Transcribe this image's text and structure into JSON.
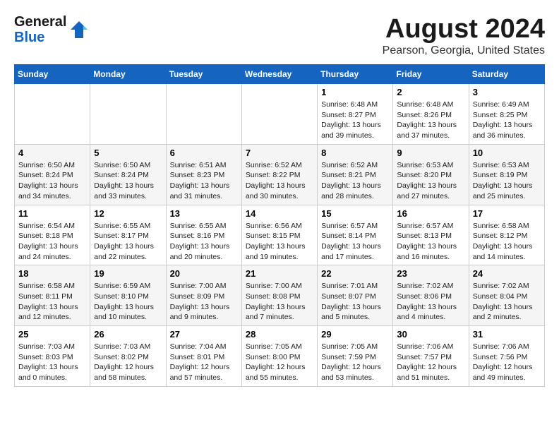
{
  "header": {
    "logo_line1": "General",
    "logo_line2": "Blue",
    "month": "August 2024",
    "location": "Pearson, Georgia, United States"
  },
  "weekdays": [
    "Sunday",
    "Monday",
    "Tuesday",
    "Wednesday",
    "Thursday",
    "Friday",
    "Saturday"
  ],
  "weeks": [
    [
      {
        "day": "",
        "info": ""
      },
      {
        "day": "",
        "info": ""
      },
      {
        "day": "",
        "info": ""
      },
      {
        "day": "",
        "info": ""
      },
      {
        "day": "1",
        "info": "Sunrise: 6:48 AM\nSunset: 8:27 PM\nDaylight: 13 hours\nand 39 minutes."
      },
      {
        "day": "2",
        "info": "Sunrise: 6:48 AM\nSunset: 8:26 PM\nDaylight: 13 hours\nand 37 minutes."
      },
      {
        "day": "3",
        "info": "Sunrise: 6:49 AM\nSunset: 8:25 PM\nDaylight: 13 hours\nand 36 minutes."
      }
    ],
    [
      {
        "day": "4",
        "info": "Sunrise: 6:50 AM\nSunset: 8:24 PM\nDaylight: 13 hours\nand 34 minutes."
      },
      {
        "day": "5",
        "info": "Sunrise: 6:50 AM\nSunset: 8:24 PM\nDaylight: 13 hours\nand 33 minutes."
      },
      {
        "day": "6",
        "info": "Sunrise: 6:51 AM\nSunset: 8:23 PM\nDaylight: 13 hours\nand 31 minutes."
      },
      {
        "day": "7",
        "info": "Sunrise: 6:52 AM\nSunset: 8:22 PM\nDaylight: 13 hours\nand 30 minutes."
      },
      {
        "day": "8",
        "info": "Sunrise: 6:52 AM\nSunset: 8:21 PM\nDaylight: 13 hours\nand 28 minutes."
      },
      {
        "day": "9",
        "info": "Sunrise: 6:53 AM\nSunset: 8:20 PM\nDaylight: 13 hours\nand 27 minutes."
      },
      {
        "day": "10",
        "info": "Sunrise: 6:53 AM\nSunset: 8:19 PM\nDaylight: 13 hours\nand 25 minutes."
      }
    ],
    [
      {
        "day": "11",
        "info": "Sunrise: 6:54 AM\nSunset: 8:18 PM\nDaylight: 13 hours\nand 24 minutes."
      },
      {
        "day": "12",
        "info": "Sunrise: 6:55 AM\nSunset: 8:17 PM\nDaylight: 13 hours\nand 22 minutes."
      },
      {
        "day": "13",
        "info": "Sunrise: 6:55 AM\nSunset: 8:16 PM\nDaylight: 13 hours\nand 20 minutes."
      },
      {
        "day": "14",
        "info": "Sunrise: 6:56 AM\nSunset: 8:15 PM\nDaylight: 13 hours\nand 19 minutes."
      },
      {
        "day": "15",
        "info": "Sunrise: 6:57 AM\nSunset: 8:14 PM\nDaylight: 13 hours\nand 17 minutes."
      },
      {
        "day": "16",
        "info": "Sunrise: 6:57 AM\nSunset: 8:13 PM\nDaylight: 13 hours\nand 16 minutes."
      },
      {
        "day": "17",
        "info": "Sunrise: 6:58 AM\nSunset: 8:12 PM\nDaylight: 13 hours\nand 14 minutes."
      }
    ],
    [
      {
        "day": "18",
        "info": "Sunrise: 6:58 AM\nSunset: 8:11 PM\nDaylight: 13 hours\nand 12 minutes."
      },
      {
        "day": "19",
        "info": "Sunrise: 6:59 AM\nSunset: 8:10 PM\nDaylight: 13 hours\nand 10 minutes."
      },
      {
        "day": "20",
        "info": "Sunrise: 7:00 AM\nSunset: 8:09 PM\nDaylight: 13 hours\nand 9 minutes."
      },
      {
        "day": "21",
        "info": "Sunrise: 7:00 AM\nSunset: 8:08 PM\nDaylight: 13 hours\nand 7 minutes."
      },
      {
        "day": "22",
        "info": "Sunrise: 7:01 AM\nSunset: 8:07 PM\nDaylight: 13 hours\nand 5 minutes."
      },
      {
        "day": "23",
        "info": "Sunrise: 7:02 AM\nSunset: 8:06 PM\nDaylight: 13 hours\nand 4 minutes."
      },
      {
        "day": "24",
        "info": "Sunrise: 7:02 AM\nSunset: 8:04 PM\nDaylight: 13 hours\nand 2 minutes."
      }
    ],
    [
      {
        "day": "25",
        "info": "Sunrise: 7:03 AM\nSunset: 8:03 PM\nDaylight: 13 hours\nand 0 minutes."
      },
      {
        "day": "26",
        "info": "Sunrise: 7:03 AM\nSunset: 8:02 PM\nDaylight: 12 hours\nand 58 minutes."
      },
      {
        "day": "27",
        "info": "Sunrise: 7:04 AM\nSunset: 8:01 PM\nDaylight: 12 hours\nand 57 minutes."
      },
      {
        "day": "28",
        "info": "Sunrise: 7:05 AM\nSunset: 8:00 PM\nDaylight: 12 hours\nand 55 minutes."
      },
      {
        "day": "29",
        "info": "Sunrise: 7:05 AM\nSunset: 7:59 PM\nDaylight: 12 hours\nand 53 minutes."
      },
      {
        "day": "30",
        "info": "Sunrise: 7:06 AM\nSunset: 7:57 PM\nDaylight: 12 hours\nand 51 minutes."
      },
      {
        "day": "31",
        "info": "Sunrise: 7:06 AM\nSunset: 7:56 PM\nDaylight: 12 hours\nand 49 minutes."
      }
    ]
  ]
}
